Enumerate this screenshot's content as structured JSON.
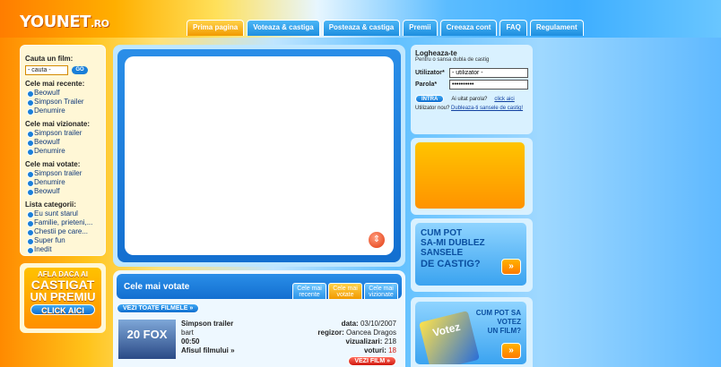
{
  "logo": {
    "name": "YOUNET",
    "tld": ".RO"
  },
  "nav": {
    "tabs": [
      "Prima pagina",
      "Voteaza & castiga",
      "Posteaza & castiga",
      "Premii",
      "Creeaza cont",
      "FAQ",
      "Regulament"
    ]
  },
  "sidebar": {
    "search_title": "Cauta un film:",
    "search_value": "- cauta -",
    "go_label": "GO",
    "recent_title": "Cele mai recente:",
    "recent": [
      "Beowulf",
      "Simpson Trailer",
      "Denumire"
    ],
    "viewed_title": "Cele mai vizionate:",
    "viewed": [
      "Simpson trailer",
      "Beowulf",
      "Denumire"
    ],
    "voted_title": "Cele mai votate:",
    "voted": [
      "Simpson trailer",
      "Denumire",
      "Beowulf"
    ],
    "categories_title": "Lista categorii:",
    "categories": [
      "Eu sunt starul",
      "Familie, prieteni,...",
      "Chestii pe care...",
      "Super fun",
      "Inedit"
    ]
  },
  "promo": {
    "line1": "AFLA DACA AI",
    "line2": "CASTIGAT",
    "line3": "UN PREMIU",
    "button": "CLICK AICI"
  },
  "player": {
    "control_icon": "play-control-icon"
  },
  "voted_section": {
    "title": "Cele mai votate",
    "tabs": [
      {
        "line1": "Cele mai",
        "line2": "recente"
      },
      {
        "line1": "Cele mai",
        "line2": "votate"
      },
      {
        "line1": "Cele mai",
        "line2": "vizionate"
      }
    ],
    "all_button": "VEZI TOATE FILMELE »",
    "movie": {
      "thumb_text": "20 FOX",
      "title": "Simpson trailer",
      "author": "bart",
      "duration": "00:50",
      "poster_link": "Afisul filmului »",
      "date_label": "data:",
      "date": "03/10/2007",
      "director_label": "regizor:",
      "director": "Oancea Dragos",
      "views_label": "vizualizari:",
      "views": "218",
      "votes_label": "voturi:",
      "votes": "18",
      "watch_button": "VEZI FILM »"
    }
  },
  "login": {
    "title": "Logheaza-te",
    "subtitle": "Pentru o sansa dubla de castig",
    "user_label": "Utilizator*",
    "user_value": "- utilizator -",
    "pass_label": "Parola*",
    "pass_value": "••••••••••",
    "submit": "INTRA",
    "forgot_text": "Ai uitat parola?",
    "forgot_link": "click aici",
    "new_text": "Utilizator nou?",
    "new_link": "Dubleaza-ti sansele de castig!"
  },
  "ad_double": {
    "line1": "CUM POT",
    "line2": "SA-MI DUBLEZ",
    "line3": "SANSELE",
    "line4": "DE CASTIG?"
  },
  "ad_vote": {
    "card": "Votez",
    "line1": "CUM POT SA",
    "line2": "VOTEZ",
    "line3": "UN FILM?"
  }
}
